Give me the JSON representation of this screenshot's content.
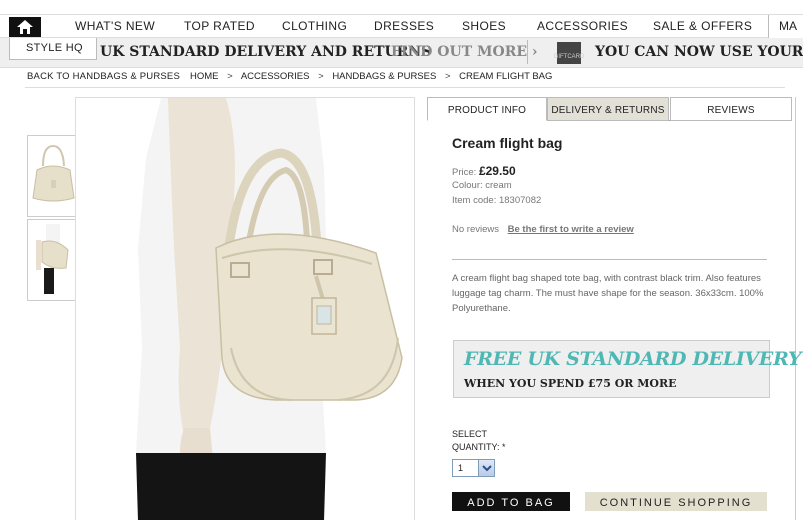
{
  "nav": {
    "items": [
      "WHAT'S NEW",
      "TOP RATED",
      "CLOTHING",
      "DRESSES",
      "SHOES",
      "ACCESSORIES",
      "SALE & OFFERS"
    ],
    "last_partial": "MA"
  },
  "promo": {
    "style_hq": "STYLE HQ",
    "delivery": "UK STANDARD DELIVERY AND RETURNS",
    "find_out": "FIND OUT MORE ›",
    "giftcard_label": "GIFTCARD",
    "gift_text": "YOU CAN NOW USE YOUR GIF"
  },
  "breadcrumb": {
    "back": "BACK TO HANDBAGS & PURSES",
    "items": [
      "HOME",
      "ACCESSORIES",
      "HANDBAGS & PURSES",
      "CREAM FLIGHT BAG"
    ],
    "separator": ">"
  },
  "tabs": [
    "PRODUCT INFO",
    "DELIVERY & RETURNS",
    "REVIEWS"
  ],
  "product": {
    "name": "Cream flight bag",
    "price_label": "Price:",
    "price": "£29.50",
    "colour": "Colour: cream",
    "item_code": "Item code: 18307082",
    "no_reviews": "No reviews",
    "review_link": "Be the first to write a review",
    "description": "A cream flight bag shaped tote bag, with contrast black trim. Also features luggage tag charm. The must have shape for the season. 36x33cm. 100% Polyurethane."
  },
  "delivery_box": {
    "title": "FREE UK STANDARD DELIVERY",
    "sub_prefix": "WHEN YOU SPEND ",
    "sub_amount": "£75",
    "sub_suffix": " OR MORE"
  },
  "quantity": {
    "select_label": "SELECT",
    "qty_label": "QUANTITY: *",
    "value": "1"
  },
  "buttons": {
    "add": "ADD TO BAG",
    "continue": "CONTINUE SHOPPING"
  },
  "colors": {
    "accent_teal": "#4fb8b4",
    "bag_cream": "#e9e3d0"
  }
}
